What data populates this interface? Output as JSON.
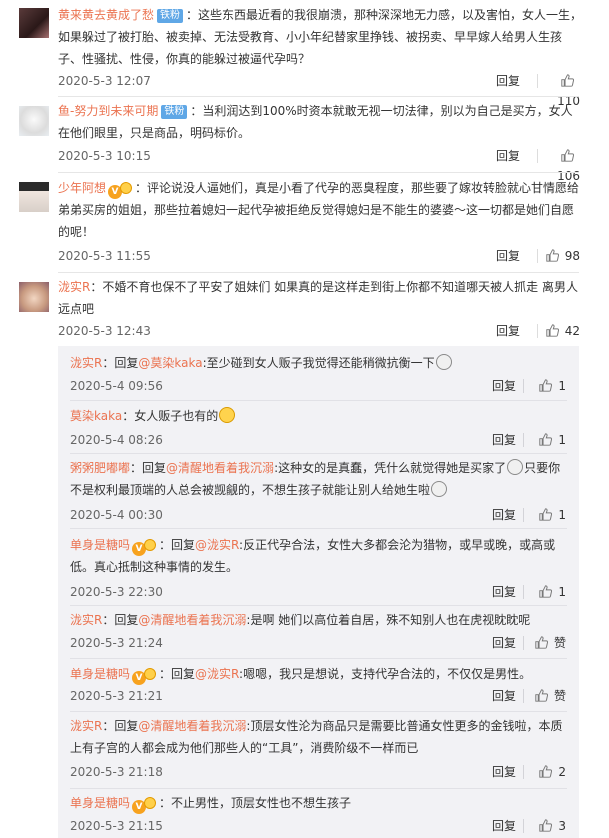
{
  "labels": {
    "reply": "回复",
    "reply_prefix": "回复",
    "reply_suffix": ":",
    "like_zan": "赞"
  },
  "colors": {
    "username": "#eb7350",
    "badge_blue": "#5fa7e6",
    "reply_bg": "#f2f2f5"
  },
  "comments": [
    {
      "user": "黄来黄去黄成了愁",
      "badge": "铁粉",
      "text": "这些东西最近看的我很崩溃，那种深深地无力感，以及害怕，女人一生，如果躲过了被打胎、被卖掉、无法受教育、小小年纪替家里挣钱、被拐卖、早早嫁人给男人生孩子、性骚扰、性侵，你真的能躲过被逼代孕吗？",
      "time": "2020-5-3 12:07",
      "likes": "110"
    },
    {
      "user": "鱼-努力到未来可期",
      "badge": "铁粉",
      "text": "当利润达到100%时资本就敢无视一切法律，别以为自己是买方，女人在他们眼里，只是商品，明码标价。",
      "time": "2020-5-3 10:15",
      "likes": "106"
    },
    {
      "user": "少年阿想",
      "text": "评论说没人逼她们，真是小看了代孕的恶臭程度，那些要了嫁妆转脸就心甘情愿给弟弟买房的姐姐，那些拉着媳妇一起代孕被拒绝反觉得媳妇是不能生的婆婆～这一切都是她们自愿的呢！",
      "time": "2020-5-3 11:55",
      "likes": "98"
    },
    {
      "user": "泷实R",
      "text": "不婚不育也保不了平安了姐妹们 如果真的是这样走到街上你都不知道哪天被人抓走 离男人远点吧",
      "time": "2020-5-3 12:43",
      "likes": "42"
    }
  ],
  "replies": [
    {
      "user": "泷实R",
      "to": "@莫染kaka",
      "text": "至少碰到女人贩子我觉得还能稍微抗衡一下",
      "time": "2020-5-4 09:56",
      "likes": "1"
    },
    {
      "user": "莫染kaka",
      "text": "女人贩子也有的",
      "time": "2020-5-4 08:26",
      "likes": "1"
    },
    {
      "user": "粥粥肥嘟嘟",
      "to": "@清醒地看着我沉溺",
      "text": "这种女的是真蠢，凭什么就觉得她是买家了",
      "text2": "只要你不是权利最顶端的人总会被觊觎的，不想生孩子就能让别人给她生啦",
      "time": "2020-5-4 00:30",
      "likes": "1"
    },
    {
      "user": "单身是糖吗",
      "to": "@泷实R",
      "text": "反正代孕合法，女性大多都会沦为猎物，或早或晚，或高或低。真心抵制这种事情的发生。",
      "time": "2020-5-3 22:30",
      "likes": "1"
    },
    {
      "user": "泷实R",
      "to": "@清醒地看着我沉溺",
      "text": "是啊 她们以高位着自居，殊不知别人也在虎视眈眈呢",
      "time": "2020-5-3 21:24",
      "likes": ""
    },
    {
      "user": "单身是糖吗",
      "to": "@泷实R",
      "text": "嗯嗯，我只是想说，支持代孕合法的，不仅仅是男性。",
      "time": "2020-5-3 21:21",
      "likes": ""
    },
    {
      "user": "泷实R",
      "to": "@清醒地看着我沉溺",
      "text": "顶层女性沦为商品只是需要比普通女性更多的金钱啦，本质上有子宫的人都会成为他们那些人的“工具”，消费阶级不一样而已",
      "time": "2020-5-3 21:18",
      "likes": "2"
    },
    {
      "user": "单身是糖吗",
      "text": "不止男性，顶层女性也不想生孩子",
      "time": "2020-5-3 21:15",
      "likes": "3"
    }
  ]
}
